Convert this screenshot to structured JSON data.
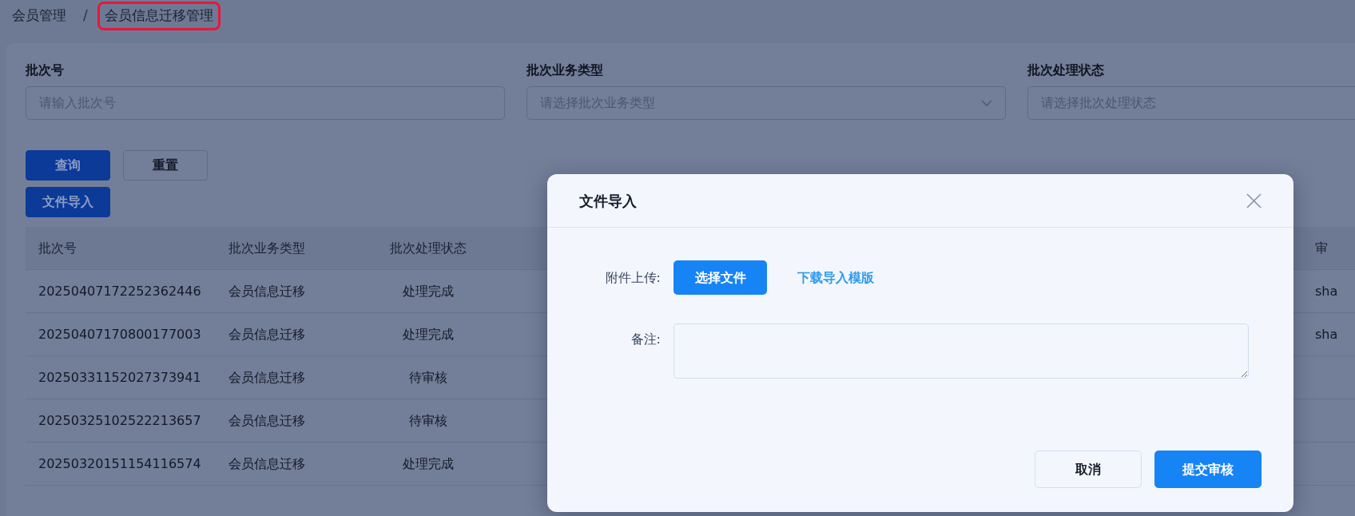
{
  "breadcrumb": {
    "separator": "/",
    "items": [
      {
        "label": "会员管理",
        "highlighted": false
      },
      {
        "label": "会员信息迁移管理",
        "highlighted": true
      }
    ]
  },
  "filters": [
    {
      "label": "批次号",
      "placeholder": "请输入批次号",
      "kind": "input"
    },
    {
      "label": "批次业务类型",
      "placeholder": "请选择批次业务类型",
      "kind": "select"
    },
    {
      "label": "批次处理状态",
      "placeholder": "请选择批次处理状态",
      "kind": "input"
    }
  ],
  "actions": [
    {
      "label": "查询",
      "kind": "primary"
    },
    {
      "label": "重置",
      "kind": "default"
    }
  ],
  "import_button": {
    "label": "文件导入"
  },
  "table": {
    "columns": [
      "批次号",
      "批次业务类型",
      "批次处理状态",
      "审"
    ],
    "rows": [
      {
        "batch_no": "20250407172252362446",
        "business_type": "会员信息迁移",
        "status": "处理完成",
        "column_4": "sha"
      },
      {
        "batch_no": "20250407170800177003",
        "business_type": "会员信息迁移",
        "status": "处理完成",
        "column_4": "sha"
      },
      {
        "batch_no": "20250331152027373941",
        "business_type": "会员信息迁移",
        "status": "待审核"
      },
      {
        "batch_no": "20250325102522213657",
        "business_type": "会员信息迁移",
        "status": "待审核"
      },
      {
        "batch_no": "20250320151154116574",
        "business_type": "会员信息迁移",
        "status": "处理完成"
      }
    ]
  },
  "modal": {
    "title": "文件导入",
    "upload_label": "附件上传:",
    "choose_button": "选择文件",
    "template_link": "下载导入模版",
    "remark_label": "备注:",
    "footer": [
      {
        "label": "取消",
        "kind": "default"
      },
      {
        "label": "提交审核",
        "kind": "primary"
      }
    ]
  }
}
